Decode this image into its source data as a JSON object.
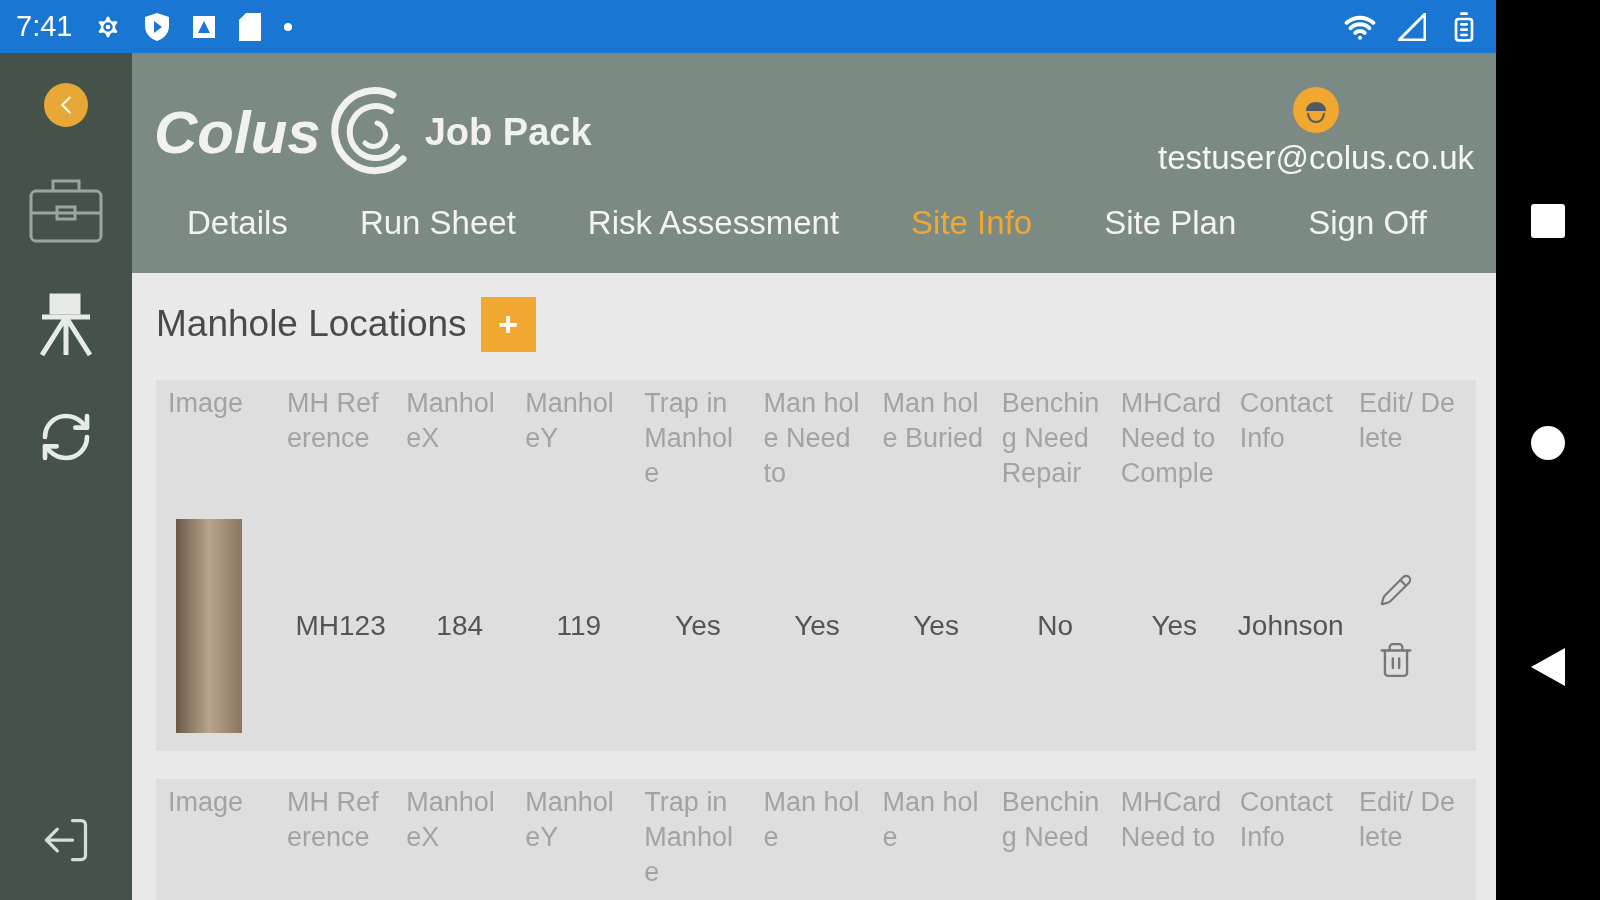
{
  "status_bar": {
    "time": "7:41"
  },
  "header": {
    "logo_text": "Colus",
    "app_title": "Job Pack",
    "user_email": "testuser@colus.co.uk"
  },
  "tabs": [
    {
      "label": "Details",
      "selected": false
    },
    {
      "label": "Run Sheet",
      "selected": false
    },
    {
      "label": "Risk Assessment",
      "selected": false
    },
    {
      "label": "Site Info",
      "selected": true
    },
    {
      "label": "Site Plan",
      "selected": false
    },
    {
      "label": "Sign Off",
      "selected": false
    }
  ],
  "section": {
    "title": "Manhole Locations",
    "add_button": "+"
  },
  "tables": [
    {
      "columns": [
        "Image",
        "MH Reference",
        "ManholeX",
        "ManholeY",
        "Trap in Manhole",
        "Man hole Need to",
        "Man hole Buried",
        "Benching Need Repair",
        "MHCard Need to Comple",
        "Contact Info",
        "Edit/ Delete"
      ],
      "rows": [
        {
          "cells": [
            "",
            "MH123",
            "184",
            "119",
            "Yes",
            "Yes",
            "Yes",
            "No",
            "Yes",
            "Johnson"
          ]
        }
      ]
    },
    {
      "columns": [
        "Image",
        "MH Reference",
        "ManholeX",
        "ManholeY",
        "Trap in Manhole",
        "Man hole",
        "Man hole",
        "Benching Need",
        "MHCard Need to",
        "Contact Info",
        "Edit/ Delete"
      ]
    }
  ]
}
